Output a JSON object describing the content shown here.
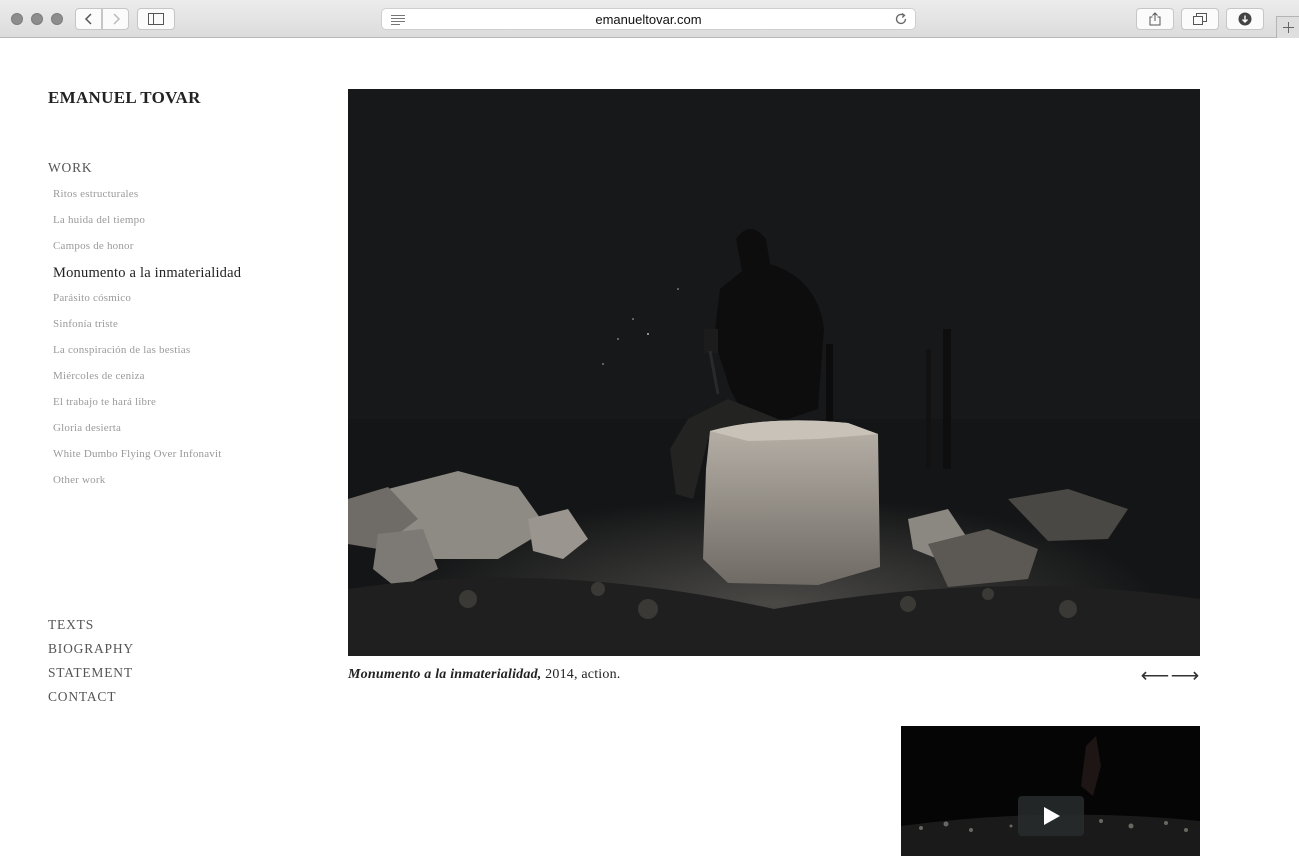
{
  "browser": {
    "url": "emanueltovar.com"
  },
  "site": {
    "title": "EMANUEL TOVAR"
  },
  "nav": {
    "work_heading": "WORK",
    "works": [
      "Ritos estructurales",
      "La huida del tiempo",
      "Campos de honor",
      "Monumento a la inmaterialidad",
      "Parásito cósmico",
      "Sinfonía triste",
      "La conspiración de las bestias",
      "Miércoles de ceniza",
      "El trabajo te hará libre",
      "Gloria desierta",
      "White Dumbo Flying Over Infonavit",
      "Other work"
    ],
    "active_index": 3,
    "pages": [
      "TEXTS",
      "BIOGRAPHY",
      "STATEMENT",
      "CONTACT"
    ]
  },
  "artwork": {
    "title": "Monumento a la inmaterialidad,",
    "details": " 2014, action.",
    "prev_arrow": "⟵",
    "next_arrow": "⟶"
  },
  "icons": {
    "photo": "artist-breaking-stone-photo",
    "video_play": "play-icon"
  },
  "colors": {
    "active_nav": "#222222",
    "inactive_nav": "#9a9a9a",
    "photo_bg": "#161718"
  }
}
